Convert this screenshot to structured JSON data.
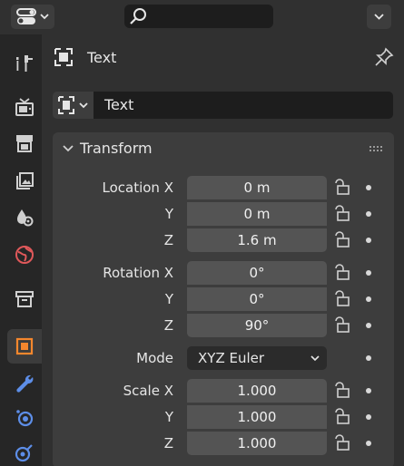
{
  "header": {
    "editor_type_icon": "properties-editor-icon",
    "search_icon": "search-icon",
    "options_icon": "chevron-down-icon"
  },
  "tabs": [
    {
      "name": "tool-icon"
    },
    {
      "name": "render-icon"
    },
    {
      "name": "output-icon"
    },
    {
      "name": "view-layer-icon"
    },
    {
      "name": "scene-icon"
    },
    {
      "name": "world-icon"
    },
    {
      "name": "collection-icon"
    },
    {
      "name": "object-icon",
      "active": true
    },
    {
      "name": "modifier-icon"
    },
    {
      "name": "particles-icon"
    },
    {
      "name": "physics-icon"
    }
  ],
  "context": {
    "title": "Text",
    "pin_icon": "pin-icon"
  },
  "datablock": {
    "name": "Text"
  },
  "panel": {
    "title": "Transform",
    "location": {
      "label_x": "Location X",
      "label_y": "Y",
      "label_z": "Z",
      "x": "0 m",
      "y": "0 m",
      "z": "1.6 m"
    },
    "rotation": {
      "label_x": "Rotation X",
      "label_y": "Y",
      "label_z": "Z",
      "x": "0°",
      "y": "0°",
      "z": "90°"
    },
    "mode": {
      "label": "Mode",
      "value": "XYZ Euler"
    },
    "scale": {
      "label_x": "Scale X",
      "label_y": "Y",
      "label_z": "Z",
      "x": "1.000",
      "y": "1.000",
      "z": "1.000"
    }
  },
  "colors": {
    "accent_orange": "#f5872d",
    "accent_blue": "#5d8ee8",
    "world_red": "#e0585a",
    "particles_purple": "#9a7cd6"
  }
}
